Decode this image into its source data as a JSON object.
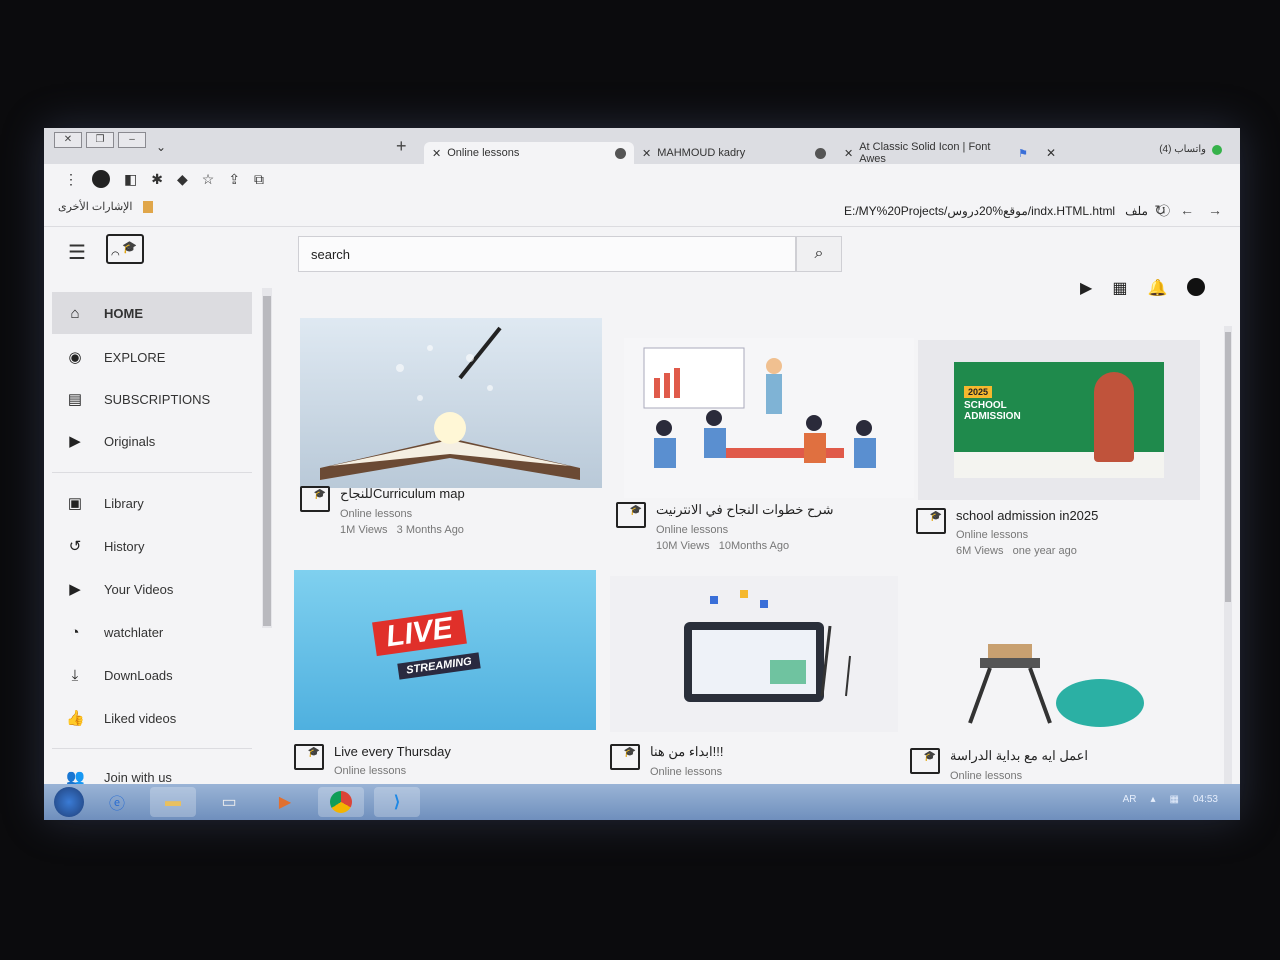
{
  "browser": {
    "tabs": [
      {
        "label": "Online lessons",
        "active": true
      },
      {
        "label": "MAHMOUD kadry",
        "active": false
      },
      {
        "label": "At Classic Solid Icon | Font Awes",
        "active": false
      }
    ],
    "new_tab": "+",
    "whatsapp": "واتساب (4)",
    "bookmarks_label": "الإشارات الأخرى",
    "address": "E:/MY%20Projects/موقع%20دروس/indx.HTML.html",
    "address_prefix": "ملف"
  },
  "header": {
    "search_placeholder": "search"
  },
  "sidebar": {
    "items": [
      {
        "label": "HOME",
        "icon": "home-icon",
        "glyph": "⌂"
      },
      {
        "label": "EXPLORE",
        "icon": "compass-icon",
        "glyph": "◉"
      },
      {
        "label": "SUBSCRIPTIONS",
        "icon": "subscriptions-icon",
        "glyph": "▤"
      },
      {
        "label": "Originals",
        "icon": "originals-icon",
        "glyph": "▶"
      },
      {
        "label": "Library",
        "icon": "library-icon",
        "glyph": "▣"
      },
      {
        "label": "History",
        "icon": "history-icon",
        "glyph": "↺"
      },
      {
        "label": "Your Videos",
        "icon": "your-videos-icon",
        "glyph": "▶"
      },
      {
        "label": "watchlater",
        "icon": "clock-icon",
        "glyph": "◔"
      },
      {
        "label": "DownLoads",
        "icon": "download-icon",
        "glyph": "⤓"
      },
      {
        "label": "Liked videos",
        "icon": "thumbs-up-icon",
        "glyph": "👍"
      },
      {
        "label": "Join with us",
        "icon": "user-plus-icon",
        "glyph": "👥"
      }
    ]
  },
  "videos": [
    {
      "title": "للنجاحCurriculum map",
      "channel": "Online lessons",
      "views": "1M Views",
      "age": "3 Months Ago"
    },
    {
      "title": "شرح خطوات النجاح في الانترنيت",
      "channel": "Online lessons",
      "views": "10M Views",
      "age": "10Months Ago"
    },
    {
      "title": "school admission in2025",
      "channel": "Online lessons",
      "views": "6M Views",
      "age": "one year ago"
    },
    {
      "title": "Live every Thursday",
      "channel": "Online lessons",
      "views": "",
      "age": ""
    },
    {
      "title": "ابداء من هنا!!!",
      "channel": "Online lessons",
      "views": "",
      "age": ""
    },
    {
      "title": "اعمل ايه مع بداية الدراسة",
      "channel": "Online lessons",
      "views": "",
      "age": ""
    }
  ],
  "thumb_text": {
    "admission_year": "2025",
    "admission_title": "SCHOOL ADMISSION",
    "live": "LIVE",
    "streaming": "STREAMING"
  },
  "taskbar": {
    "lang": "AR",
    "time": "04:53"
  }
}
